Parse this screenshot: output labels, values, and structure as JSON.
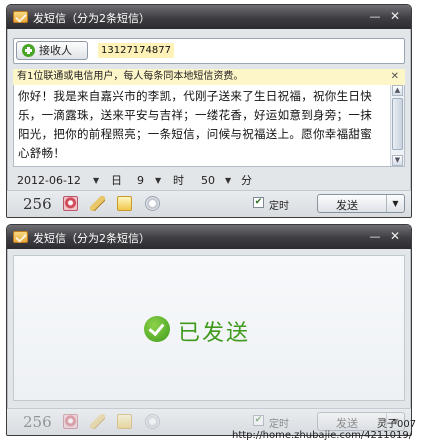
{
  "window1": {
    "title": "发短信（分为2条短信）",
    "recipient_button_label": "接收人",
    "recipient_number": "13127174877",
    "info_text": "有1位联通或电信用户，每人每条同本地短信资费。",
    "message": "你好！我是来自嘉兴市的李凯，代刚子送来了生日祝福，祝你生日快乐，一滴露珠，送来平安与吉祥；一缕花香，好运如意到身旁；一抹阳光，把你的前程照亮；一条短信，问候与祝福送上。愿你幸福甜蜜心舒畅！",
    "schedule": {
      "date": "2012-06-12",
      "day_label": "日",
      "hour": "9",
      "hour_label": "时",
      "minute": "50",
      "minute_label": "分"
    },
    "char_count": "256",
    "timer_label": "定时",
    "timer_checked": true,
    "send_label": "发送"
  },
  "window2": {
    "title": "发短信（分为2条短信）",
    "sent_status": "已发送",
    "char_count": "256",
    "timer_label": "定时",
    "send_label": "发送"
  },
  "watermark": {
    "author": "灵子007",
    "url": "http://home.zhubajie.com/4211019/"
  },
  "colors": {
    "titlebar": "#3d3d42",
    "success_green": "#3f9a1c",
    "info_bg": "#fdf6c9"
  }
}
